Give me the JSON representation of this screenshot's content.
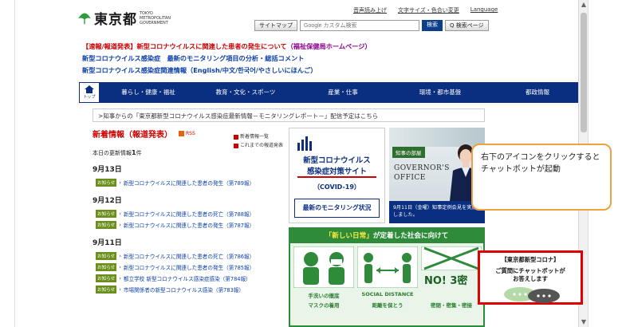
{
  "header": {
    "logo_text": "東京都",
    "logo_en": "TOKYO METROPOLITAN GOVERNMENT",
    "top_links": [
      "音声読み上げ",
      "文字サイズ・色合い変更",
      "Language"
    ],
    "sitemap_label": "サイトマップ",
    "search_placeholder": "Google カスタム検索",
    "search_button": "検索",
    "voice_button": "Q 検索ページ"
  },
  "notices": {
    "line1_prefix": "【速報/報道発表】",
    "line1_text": "新型コロナウイルスに関連した患者の発生について",
    "line1_link": "（福祉保健局ホームページ）",
    "line2": "新型コロナウイルス感染症　最新のモニタリング項目の分析・総括コメント",
    "line3": "新型コロナウイルス感染症関連情報（English/中文/한국어/やさしいにほんご）"
  },
  "nav": {
    "home_label": "トップ",
    "items": [
      "暮らし・健康・福祉",
      "教育・文化・スポーツ",
      "産業・仕事",
      "環境・都市基盤",
      "都政情報"
    ]
  },
  "announcement": ">知事からの「東京都新型コロナウイルス感染症最新情報－モニタリングレポート－」配信予定はこちら",
  "news": {
    "title": "新着情報（報道発表）",
    "rss": "RSS",
    "side_links": [
      "新着情報一覧",
      "これまでの報道発表"
    ],
    "updates_prefix": "本日の更新情報",
    "updates_count": "1",
    "updates_suffix": "件",
    "tag": "お知らせ",
    "sections": [
      {
        "date": "9月13日",
        "items": [
          "新型コロナウイルスに関連した患者の発生（第789報）"
        ]
      },
      {
        "date": "9月12日",
        "items": [
          "新型コロナウイルスに関連した患者の死亡（第788報）",
          "新型コロナウイルスに関連した患者の発生（第787報）"
        ]
      },
      {
        "date": "9月11日",
        "items": [
          "新型コロナウイルスに関連した患者の死亡（第786報）",
          "新型コロナウイルスに関連した患者の発生（第785報）",
          "都立学校 新型コロナウイルス感染症感染（第784報）",
          "市場関係者の新型コロナウイルス感染（第783報）"
        ]
      }
    ]
  },
  "covid_site": {
    "line1": "新型コロナウイルス",
    "line2": "感染症対策サイト",
    "line3": "（COVID-19）",
    "monitor": "最新のモニタリング状況"
  },
  "governor": {
    "tag": "知事の部屋",
    "title_line1": "GOVERNOR'S",
    "title_line2": "OFFICE",
    "caption": "9月11日（金曜）知事定例会見を実施しました。"
  },
  "new_normal": {
    "banner_open": "「新しい日常」",
    "banner_rest": "が定着した社会に向けて",
    "label1": "手洗いの徹底",
    "label2": "マスクの着用",
    "label3": "SOCIAL DISTANCE",
    "label4": "距離を保とう",
    "label5": "NO! 3密",
    "label6": "密閉・密集・密接"
  },
  "callout_text": "右下のアイコンをクリックするとチャットボットが起動",
  "chatbot": {
    "line1": "【東京都新型コロナ】",
    "line2": "ご質問にチャットボットが",
    "line3": "お答えします"
  },
  "colors": {
    "nav_blue": "#0b2f80",
    "notice_red": "#cc0000",
    "news_green": "#2e8b3a",
    "callout_orange": "#f0a040"
  }
}
